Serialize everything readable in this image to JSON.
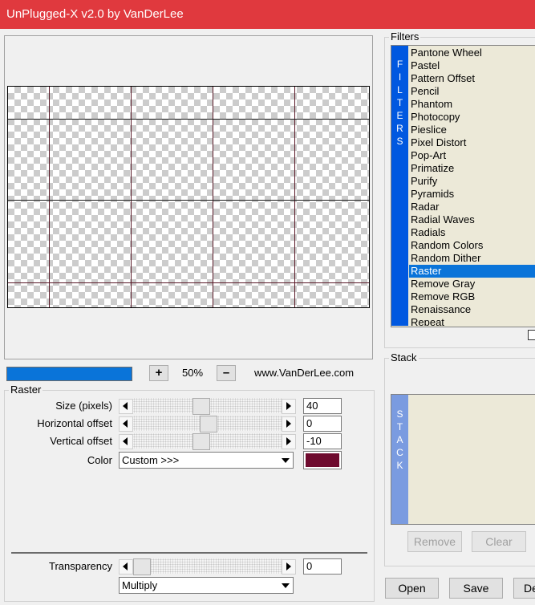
{
  "window": {
    "title": "UnPlugged-X v2.0 by VanDerLee"
  },
  "preview": {
    "zoom": "50%",
    "zoom_in_label": "+",
    "zoom_out_label": "–",
    "progress": 1.0,
    "website": "www.VanDerLee.com"
  },
  "raster": {
    "group_label": "Raster",
    "size": {
      "label": "Size (pixels)",
      "value": "40",
      "slider_fraction": 0.45
    },
    "hoffset": {
      "label": "Horizontal offset",
      "value": "0",
      "slider_fraction": 0.5
    },
    "voffset": {
      "label": "Vertical offset",
      "value": "-10",
      "slider_fraction": 0.45
    },
    "color": {
      "label": "Color",
      "preset": "Custom >>>",
      "value": "#6e0a2e"
    },
    "transparency": {
      "label": "Transparency",
      "value": "0",
      "slider_fraction": 0.0
    },
    "blend_mode": "Multiply"
  },
  "filters": {
    "group_label": "Filters",
    "sidebar_letters": [
      "F",
      "I",
      "L",
      "T",
      "E",
      "R",
      "S"
    ],
    "items": [
      "Pantone Wheel",
      "Pastel",
      "Pattern Offset",
      "Pencil",
      "Phantom",
      "Photocopy",
      "Pieslice",
      "Pixel Distort",
      "Pop-Art",
      "Primatize",
      "Purify",
      "Pyramids",
      "Radar",
      "Radial Waves",
      "Radials",
      "Random Colors",
      "Random Dither",
      "Raster",
      "Remove Gray",
      "Remove RGB",
      "Renaissance",
      "Repeat"
    ],
    "selected": "Raster"
  },
  "stack": {
    "group_label": "Stack",
    "sidebar_letters": [
      "S",
      "T",
      "A",
      "C",
      "K"
    ],
    "remove_label": "Remove",
    "clear_label": "Clear"
  },
  "buttons": {
    "open": "Open",
    "save": "Save",
    "default": "De"
  },
  "colors": {
    "titlebar": "#e0393e",
    "selection": "#0a74d9",
    "filters_bar": "#0058e0",
    "stack_bar": "#7a9be0"
  }
}
